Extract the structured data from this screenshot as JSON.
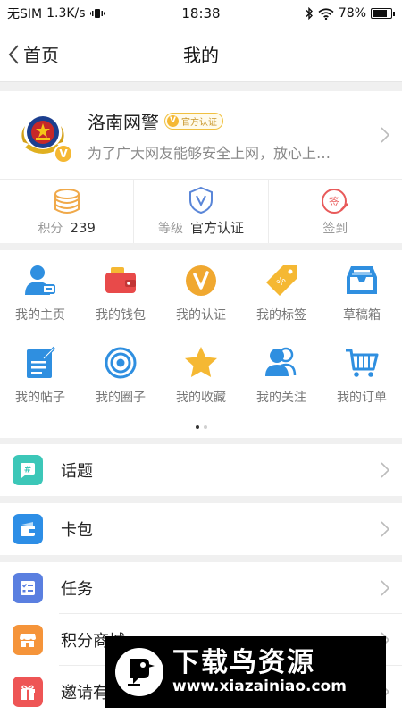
{
  "status_bar": {
    "carrier": "无SIM",
    "speed": "1.3K/s",
    "time": "18:38",
    "battery": "78%",
    "battery_level": 0.78
  },
  "nav": {
    "back_label": "首页",
    "title": "我的"
  },
  "profile": {
    "name": "洛南网警",
    "badge": "官方认证",
    "description": "为了广大网友能够安全上网，放心上…"
  },
  "stats": [
    {
      "label": "积分",
      "value": "239",
      "icon": "coins-icon"
    },
    {
      "label": "等级",
      "value": "官方认证",
      "icon": "shield-v-icon"
    },
    {
      "label": "签到",
      "value": "",
      "icon": "sign-in-icon"
    }
  ],
  "grid": [
    {
      "label": "我的主页",
      "icon": "user-page-icon"
    },
    {
      "label": "我的钱包",
      "icon": "wallet-icon"
    },
    {
      "label": "我的认证",
      "icon": "verify-icon"
    },
    {
      "label": "我的标签",
      "icon": "tag-icon"
    },
    {
      "label": "草稿箱",
      "icon": "draft-box-icon"
    },
    {
      "label": "我的帖子",
      "icon": "post-icon"
    },
    {
      "label": "我的圈子",
      "icon": "circle-icon"
    },
    {
      "label": "我的收藏",
      "icon": "star-icon"
    },
    {
      "label": "我的关注",
      "icon": "follow-icon"
    },
    {
      "label": "我的订单",
      "icon": "cart-icon"
    }
  ],
  "menu": [
    {
      "label": "话题",
      "icon": "topic-icon",
      "color": "#3cc7b8"
    },
    {
      "label": "卡包",
      "icon": "card-icon",
      "color": "#2d8ee6"
    },
    {
      "label": "任务",
      "icon": "task-icon",
      "color": "#5a7fe0"
    },
    {
      "label": "积分商城",
      "icon": "store-icon",
      "color": "#f5943a"
    },
    {
      "label": "邀请有礼",
      "icon": "gift-icon",
      "color": "#ee5555"
    }
  ],
  "watermark": {
    "title": "下载鸟资源",
    "url": "www.xiazainiao.com"
  },
  "colors": {
    "accent_blue": "#2f8fe0",
    "accent_orange": "#f5b833",
    "menu_teal": "#3cc7b8"
  }
}
